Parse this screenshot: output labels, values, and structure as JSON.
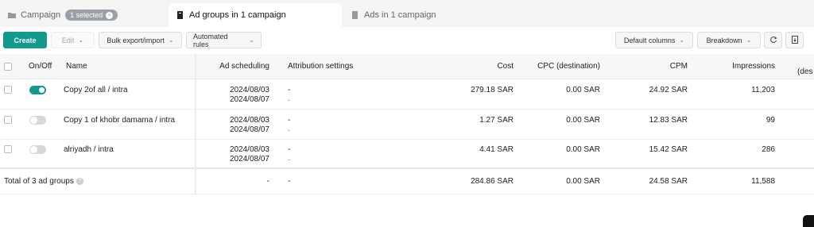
{
  "tabs": {
    "campaign": {
      "label": "Campaign",
      "badge": "1 selected"
    },
    "adgroups": {
      "label": "Ad groups in 1 campaign"
    },
    "ads": {
      "label": "Ads in 1 campaign"
    }
  },
  "toolbar": {
    "create": "Create",
    "edit": "Edit",
    "bulk": "Bulk export/import",
    "rules": "Automated rules",
    "columns": "Default columns",
    "breakdown": "Breakdown"
  },
  "table": {
    "headers": {
      "onoff": "On/Off",
      "name": "Name",
      "scheduling": "Ad scheduling",
      "attribution": "Attribution settings",
      "cost": "Cost",
      "cpc": "CPC (destination)",
      "cpm": "CPM",
      "impressions": "Impressions",
      "overflow": "(des"
    },
    "rows": [
      {
        "on": true,
        "name": "Copy 2of all / intra",
        "sched1": "2024/08/03",
        "sched2": "2024/08/07",
        "attr": "-",
        "attr2": "-",
        "cost": "279.18 SAR",
        "cpc": "0.00 SAR",
        "cpm": "24.92 SAR",
        "impressions": "11,203"
      },
      {
        "on": false,
        "name": "Copy 1 of khobr damama / intra",
        "sched1": "2024/08/03",
        "sched2": "2024/08/07",
        "attr": "-",
        "attr2": "-",
        "cost": "1.27 SAR",
        "cpc": "0.00 SAR",
        "cpm": "12.83 SAR",
        "impressions": "99"
      },
      {
        "on": false,
        "name": "alriyadh / intra",
        "sched1": "2024/08/03",
        "sched2": "2024/08/07",
        "attr": "-",
        "attr2": "-",
        "cost": "4.41 SAR",
        "cpc": "0.00 SAR",
        "cpm": "15.42 SAR",
        "impressions": "286"
      }
    ],
    "total": {
      "label": "Total of 3 ad groups",
      "sched": "-",
      "attr": "-",
      "cost": "284.86 SAR",
      "cpc": "0.00 SAR",
      "cpm": "24.58 SAR",
      "impressions": "11,588"
    }
  },
  "colors": {
    "accent": "#129a8c"
  }
}
